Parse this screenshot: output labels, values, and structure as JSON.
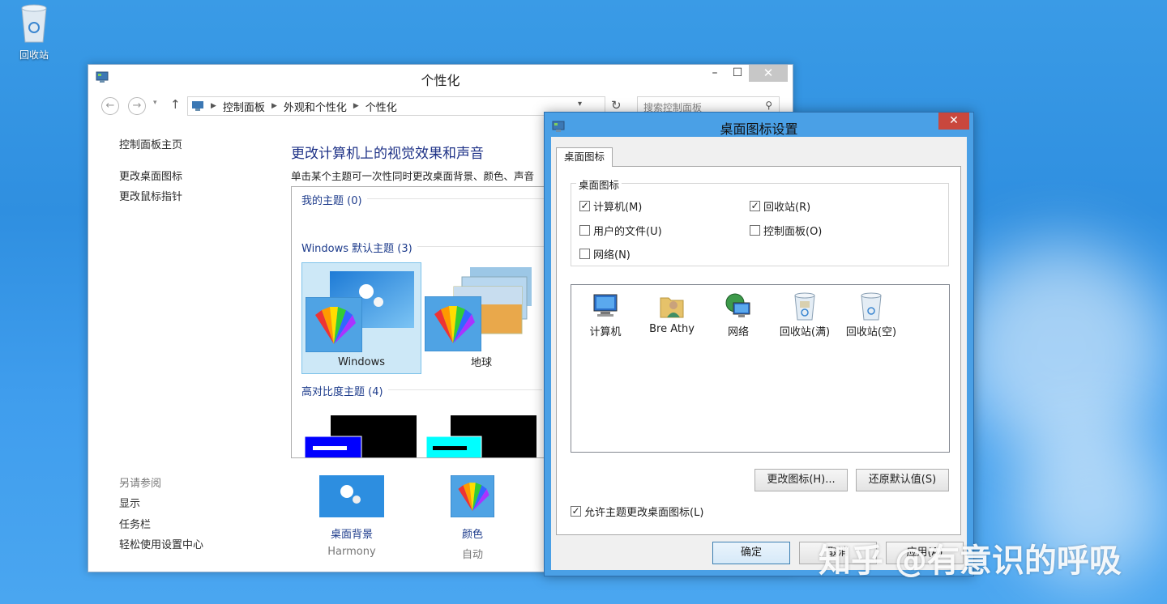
{
  "desktop": {
    "recycle_bin_label": "回收站"
  },
  "main_window": {
    "title": "个性化",
    "breadcrumb": [
      "控制面板",
      "外观和个性化",
      "个性化"
    ],
    "search_placeholder": "搜索控制面板",
    "sidebar": {
      "home": "控制面板主页",
      "links": [
        "更改桌面图标",
        "更改鼠标指针"
      ],
      "see_also_label": "另请参阅",
      "see_also": [
        "显示",
        "任务栏",
        "轻松使用设置中心"
      ]
    },
    "heading": "更改计算机上的视觉效果和声音",
    "subheading": "单击某个主题可一次性同时更改桌面背景、颜色、声音",
    "sections": {
      "my_themes": "我的主题 (0)",
      "default_themes": "Windows 默认主题 (3)",
      "high_contrast": "高对比度主题 (4)"
    },
    "themes": [
      "Windows",
      "地球"
    ],
    "bottom": [
      {
        "label": "桌面背景",
        "value": "Harmony"
      },
      {
        "label": "颜色",
        "value": "自动"
      }
    ]
  },
  "dialog": {
    "title": "桌面图标设置",
    "tab": "桌面图标",
    "group_title": "桌面图标",
    "checkboxes": [
      {
        "label": "计算机(M)",
        "checked": true
      },
      {
        "label": "回收站(R)",
        "checked": true
      },
      {
        "label": "用户的文件(U)",
        "checked": false
      },
      {
        "label": "控制面板(O)",
        "checked": false
      },
      {
        "label": "网络(N)",
        "checked": false
      }
    ],
    "icons": [
      "计算机",
      "Bre Athy",
      "网络",
      "回收站(满)",
      "回收站(空)"
    ],
    "change_icon_button": "更改图标(H)...",
    "restore_default_button": "还原默认值(S)",
    "allow_themes_checkbox": {
      "label": "允许主题更改桌面图标(L)",
      "checked": true
    },
    "ok_button": "确定",
    "cancel_button": "取消",
    "apply_button": "应用(A)"
  },
  "watermark": "知乎 @有意识的呼吸",
  "colors": {
    "desktop_bg": "#3a9be6",
    "link_blue": "#1e3c8c",
    "heading_blue": "#1e3287",
    "dialog_frame": "#4aa0e6",
    "close_red": "#c9473d",
    "selection": "#cde8f7"
  }
}
